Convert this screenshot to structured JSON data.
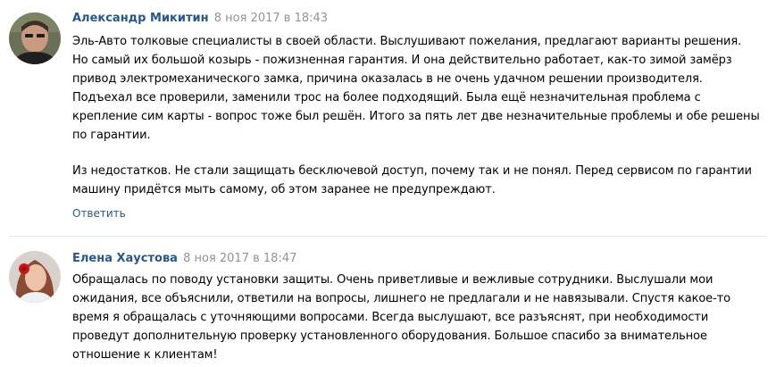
{
  "comments": [
    {
      "author": "Александр Микитин",
      "date": "8 ноя 2017 в 18:43",
      "lines": [
        "Эль-Авто толковые специалисты в своей области. Выслушивают пожелания, предлагают варианты решения.",
        "Но самый их большой козырь - пожизненная гарантия. И она действительно работает, как-то зимой замёрз",
        "привод электромеханического замка, причина оказалась в не очень удачном решении производителя.",
        "Подъехал все проверили, заменили трос на более подходящий. Была ещё незначительная проблема с",
        "крепление сим карты - вопрос тоже был решён. Итого за пять лет две незначительные проблемы и обе решены",
        "по гарантии.",
        "Из недостатков. Не стали защищать бесключевой доступ, почему так и не понял. Перед сервисом по гарантии",
        "машину придётся мыть самому, об этом заранее не предупреждают."
      ],
      "reply_label": "Ответить"
    },
    {
      "author": "Елена Хаустова",
      "date": "8 ноя 2017 в 18:47",
      "lines": [
        "Обращалась по поводу установки защиты. Очень приветливые и вежливые сотрудники. Выслушали мои",
        "ожидания, все объяснили, ответили на вопросы, лишнего не предлагали и не навязывали. Спустя какое-то",
        "время я обращалась с уточняющими вопросами. Всегда выслушают, все разъяснят, при необходимости",
        "проведут дополнительную проверку установленного оборудования. Большое спасибо за внимательное",
        "отношение к клиентам!"
      ]
    }
  ],
  "colors": {
    "author": "#2a5885",
    "date": "#939393",
    "divider": "#e7e8ec"
  }
}
